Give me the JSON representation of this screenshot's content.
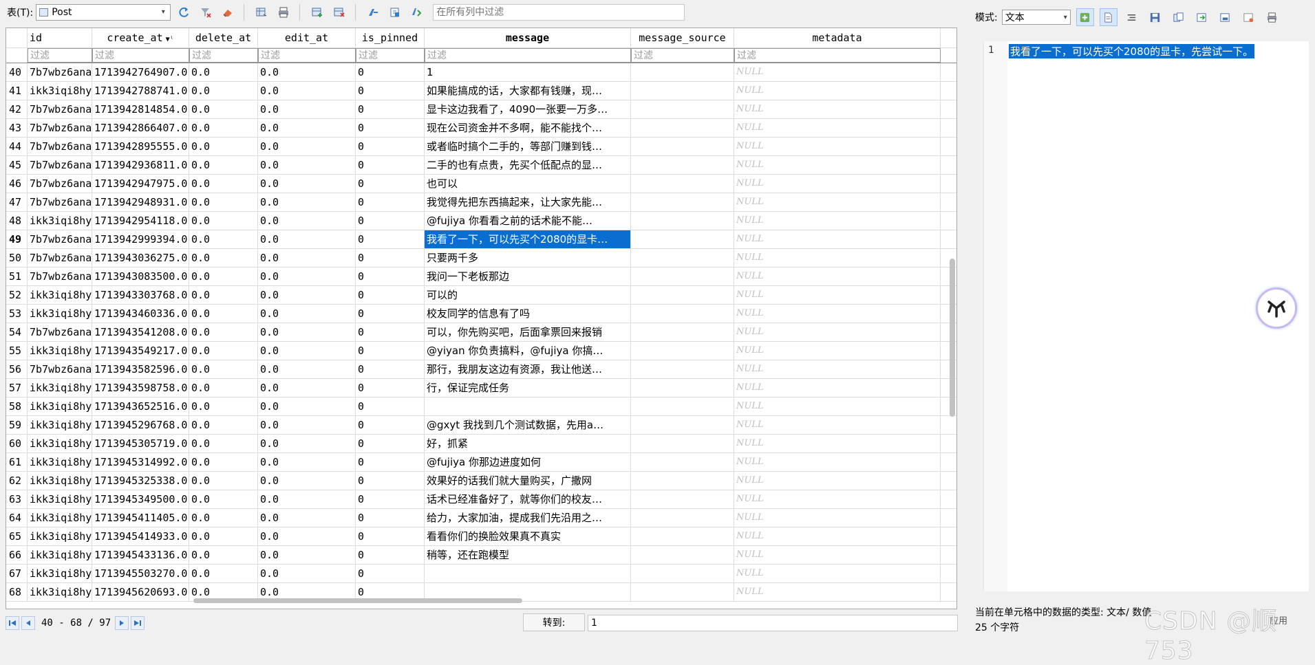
{
  "toolbar": {
    "table_label": "表(T):",
    "table_value": "Post",
    "filter_all_placeholder": "在所有列中过滤"
  },
  "columns": [
    "id",
    "create_at",
    "delete_at",
    "edit_at",
    "is_pinned",
    "message",
    "message_source",
    "metadata"
  ],
  "filter_placeholder": "过滤",
  "rows": [
    {
      "n": "40",
      "id": "7b7wbz6ana",
      "ca": "1713942764907.0",
      "da": "0.0",
      "ea": "0.0",
      "ip": "0",
      "msg": "1",
      "ms": "",
      "md": "NULL"
    },
    {
      "n": "41",
      "id": "ikk3iqi8hy",
      "ca": "1713942788741.0",
      "da": "0.0",
      "ea": "0.0",
      "ip": "0",
      "msg": "如果能搞成的话，大家都有钱赚，现…",
      "ms": "",
      "md": "NULL"
    },
    {
      "n": "42",
      "id": "7b7wbz6ana",
      "ca": "1713942814854.0",
      "da": "0.0",
      "ea": "0.0",
      "ip": "0",
      "msg": "显卡这边我看了，4090一张要一万多…",
      "ms": "",
      "md": "NULL"
    },
    {
      "n": "43",
      "id": "7b7wbz6ana",
      "ca": "1713942866407.0",
      "da": "0.0",
      "ea": "0.0",
      "ip": "0",
      "msg": "现在公司资金并不多啊，能不能找个…",
      "ms": "",
      "md": "NULL"
    },
    {
      "n": "44",
      "id": "7b7wbz6ana",
      "ca": "1713942895555.0",
      "da": "0.0",
      "ea": "0.0",
      "ip": "0",
      "msg": "或者临时搞个二手的，等部门赚到钱…",
      "ms": "",
      "md": "NULL"
    },
    {
      "n": "45",
      "id": "7b7wbz6ana",
      "ca": "1713942936811.0",
      "da": "0.0",
      "ea": "0.0",
      "ip": "0",
      "msg": "二手的也有点贵，先买个低配点的显…",
      "ms": "",
      "md": "NULL"
    },
    {
      "n": "46",
      "id": "7b7wbz6ana",
      "ca": "1713942947975.0",
      "da": "0.0",
      "ea": "0.0",
      "ip": "0",
      "msg": "也可以",
      "ms": "",
      "md": "NULL"
    },
    {
      "n": "47",
      "id": "7b7wbz6ana",
      "ca": "1713942948931.0",
      "da": "0.0",
      "ea": "0.0",
      "ip": "0",
      "msg": "我觉得先把东西搞起来，让大家先能…",
      "ms": "",
      "md": "NULL"
    },
    {
      "n": "48",
      "id": "ikk3iqi8hy",
      "ca": "1713942954118.0",
      "da": "0.0",
      "ea": "0.0",
      "ip": "0",
      "msg": "@fujiya 你看看之前的话术能不能…",
      "ms": "",
      "md": "NULL"
    },
    {
      "n": "49",
      "id": "7b7wbz6ana",
      "ca": "1713942999394.0",
      "da": "0.0",
      "ea": "0.0",
      "ip": "0",
      "msg": "我看了一下，可以先买个2080的显卡…",
      "ms": "",
      "md": "NULL",
      "selected": true
    },
    {
      "n": "50",
      "id": "7b7wbz6ana",
      "ca": "1713943036275.0",
      "da": "0.0",
      "ea": "0.0",
      "ip": "0",
      "msg": "只要两千多",
      "ms": "",
      "md": "NULL"
    },
    {
      "n": "51",
      "id": "7b7wbz6ana",
      "ca": "1713943083500.0",
      "da": "0.0",
      "ea": "0.0",
      "ip": "0",
      "msg": "我问一下老板那边",
      "ms": "",
      "md": "NULL"
    },
    {
      "n": "52",
      "id": "ikk3iqi8hy",
      "ca": "1713943303768.0",
      "da": "0.0",
      "ea": "0.0",
      "ip": "0",
      "msg": "可以的",
      "ms": "",
      "md": "NULL"
    },
    {
      "n": "53",
      "id": "ikk3iqi8hy",
      "ca": "1713943460336.0",
      "da": "0.0",
      "ea": "0.0",
      "ip": "0",
      "msg": "校友同学的信息有了吗",
      "ms": "",
      "md": "NULL"
    },
    {
      "n": "54",
      "id": "7b7wbz6ana",
      "ca": "1713943541208.0",
      "da": "0.0",
      "ea": "0.0",
      "ip": "0",
      "msg": "可以，你先购买吧，后面拿票回来报销",
      "ms": "",
      "md": "NULL"
    },
    {
      "n": "55",
      "id": "ikk3iqi8hy",
      "ca": "1713943549217.0",
      "da": "0.0",
      "ea": "0.0",
      "ip": "0",
      "msg": "@yiyan 你负责搞料，@fujiya 你搞…",
      "ms": "",
      "md": "NULL"
    },
    {
      "n": "56",
      "id": "7b7wbz6ana",
      "ca": "1713943582596.0",
      "da": "0.0",
      "ea": "0.0",
      "ip": "0",
      "msg": "那行，我朋友这边有资源，我让他送…",
      "ms": "",
      "md": "NULL"
    },
    {
      "n": "57",
      "id": "ikk3iqi8hy",
      "ca": "1713943598758.0",
      "da": "0.0",
      "ea": "0.0",
      "ip": "0",
      "msg": "行，保证完成任务",
      "ms": "",
      "md": "NULL"
    },
    {
      "n": "58",
      "id": "ikk3iqi8hy",
      "ca": "1713943652516.0",
      "da": "0.0",
      "ea": "0.0",
      "ip": "0",
      "msg": "",
      "ms": "",
      "md": "NULL"
    },
    {
      "n": "59",
      "id": "ikk3iqi8hy",
      "ca": "1713945296768.0",
      "da": "0.0",
      "ea": "0.0",
      "ip": "0",
      "msg": "@gxyt 我找到几个测试数据，先用a…",
      "ms": "",
      "md": "NULL"
    },
    {
      "n": "60",
      "id": "ikk3iqi8hy",
      "ca": "1713945305719.0",
      "da": "0.0",
      "ea": "0.0",
      "ip": "0",
      "msg": "好，抓紧",
      "ms": "",
      "md": "NULL"
    },
    {
      "n": "61",
      "id": "ikk3iqi8hy",
      "ca": "1713945314992.0",
      "da": "0.0",
      "ea": "0.0",
      "ip": "0",
      "msg": "@fujiya 你那边进度如何",
      "ms": "",
      "md": "NULL"
    },
    {
      "n": "62",
      "id": "ikk3iqi8hy",
      "ca": "1713945325338.0",
      "da": "0.0",
      "ea": "0.0",
      "ip": "0",
      "msg": "效果好的话我们就大量购买，广撒网",
      "ms": "",
      "md": "NULL"
    },
    {
      "n": "63",
      "id": "ikk3iqi8hy",
      "ca": "1713945349500.0",
      "da": "0.0",
      "ea": "0.0",
      "ip": "0",
      "msg": "话术已经准备好了，就等你们的校友…",
      "ms": "",
      "md": "NULL"
    },
    {
      "n": "64",
      "id": "ikk3iqi8hy",
      "ca": "1713945411405.0",
      "da": "0.0",
      "ea": "0.0",
      "ip": "0",
      "msg": "给力，大家加油，提成我们先沿用之…",
      "ms": "",
      "md": "NULL"
    },
    {
      "n": "65",
      "id": "ikk3iqi8hy",
      "ca": "1713945414933.0",
      "da": "0.0",
      "ea": "0.0",
      "ip": "0",
      "msg": "看看你们的换脸效果真不真实",
      "ms": "",
      "md": "NULL"
    },
    {
      "n": "66",
      "id": "ikk3iqi8hy",
      "ca": "1713945433136.0",
      "da": "0.0",
      "ea": "0.0",
      "ip": "0",
      "msg": "稍等，还在跑模型",
      "ms": "",
      "md": "NULL"
    },
    {
      "n": "67",
      "id": "ikk3iqi8hy",
      "ca": "1713945503270.0",
      "da": "0.0",
      "ea": "0.0",
      "ip": "0",
      "msg": "",
      "ms": "",
      "md": "NULL"
    },
    {
      "n": "68",
      "id": "ikk3iqi8hy",
      "ca": "1713945620693.0",
      "da": "0.0",
      "ea": "0.0",
      "ip": "0",
      "msg": "",
      "ms": "",
      "md": "NULL"
    }
  ],
  "footer": {
    "page_range": "40 - 68 / 97",
    "goto_label": "转到:",
    "goto_value": "1"
  },
  "right_panel": {
    "mode_label": "模式:",
    "mode_value": "文本",
    "line_number": "1",
    "cell_text": "我看了一下，可以先买个2080的显卡，先尝试一下。",
    "status_type": "当前在单元格中的数据的类型: 文本/ 数值",
    "status_chars": "25 个字符",
    "applied_label": "应用",
    "watermark": "CSDN @顺753"
  },
  "colors": {
    "selection": "#0a6ed1",
    "null_text": "#c0c0c0"
  }
}
